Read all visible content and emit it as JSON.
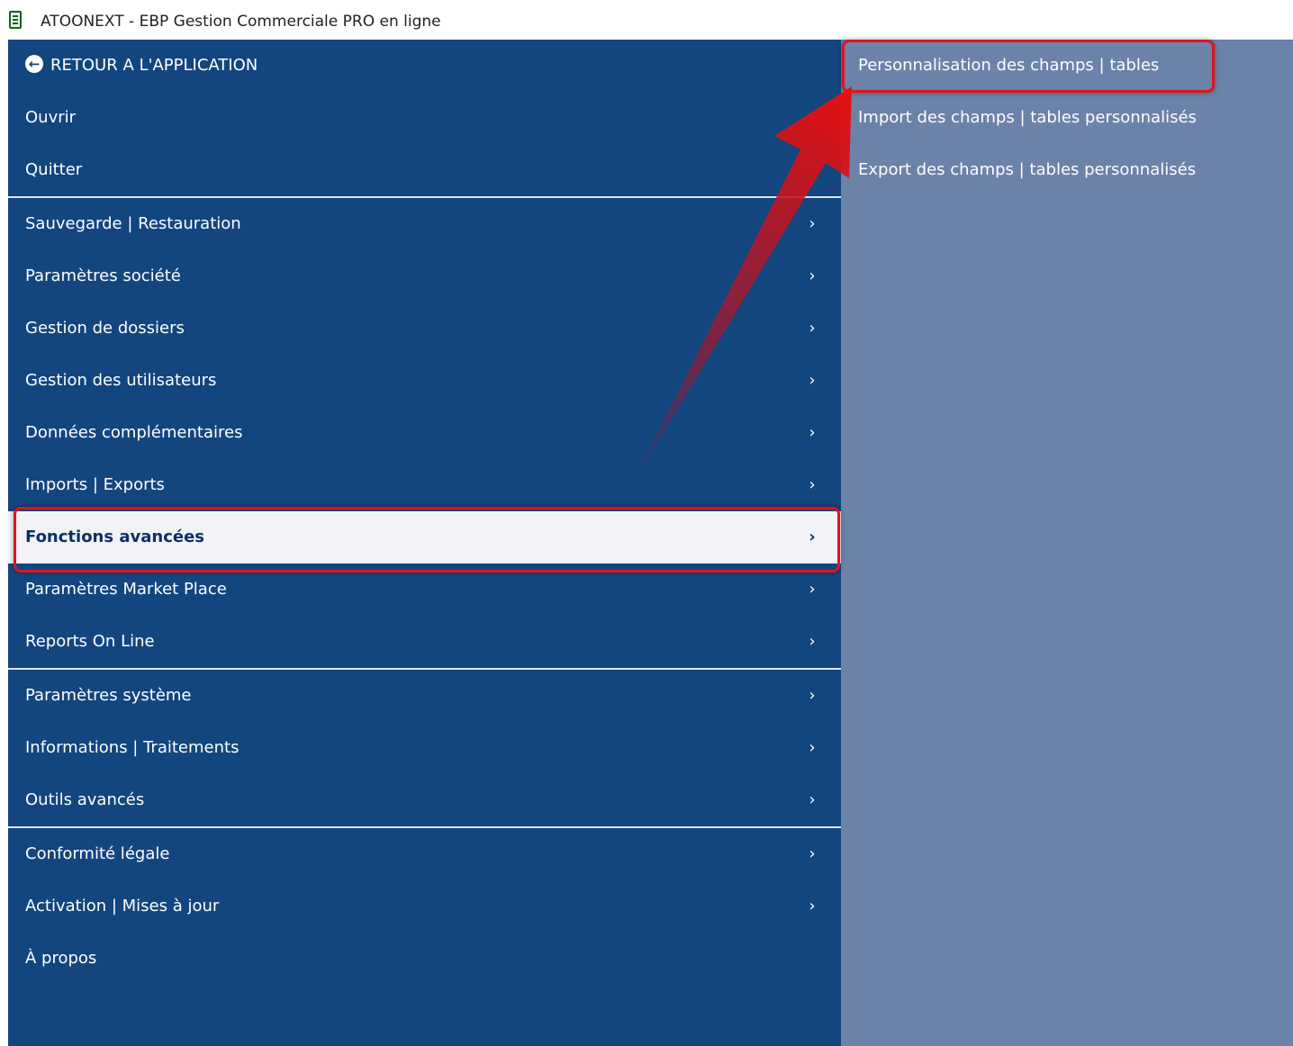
{
  "window": {
    "title": "ATOONEXT - EBP Gestion Commerciale PRO en ligne",
    "icon": "app-document-icon"
  },
  "menu": {
    "back_label": "RETOUR A L'APPLICATION",
    "items": [
      {
        "label": "Ouvrir",
        "has_submenu": true
      },
      {
        "label": "Quitter",
        "has_submenu": false
      },
      {
        "label": "Sauvegarde | Restauration",
        "has_submenu": true
      },
      {
        "label": "Paramètres société",
        "has_submenu": true
      },
      {
        "label": "Gestion de dossiers",
        "has_submenu": true
      },
      {
        "label": "Gestion des utilisateurs",
        "has_submenu": true
      },
      {
        "label": "Données complémentaires",
        "has_submenu": true
      },
      {
        "label": "Imports | Exports",
        "has_submenu": true
      },
      {
        "label": "Fonctions avancées",
        "has_submenu": true,
        "selected": true
      },
      {
        "label": "Paramètres Market Place",
        "has_submenu": true
      },
      {
        "label": "Reports On Line",
        "has_submenu": true
      },
      {
        "label": "Paramètres système",
        "has_submenu": true
      },
      {
        "label": "Informations | Traitements",
        "has_submenu": true
      },
      {
        "label": "Outils avancés",
        "has_submenu": true
      },
      {
        "label": "Conformité légale",
        "has_submenu": true
      },
      {
        "label": "Activation | Mises à jour",
        "has_submenu": true
      },
      {
        "label": "À propos",
        "has_submenu": false
      }
    ]
  },
  "submenu": {
    "items": [
      {
        "label": "Personnalisation des champs | tables",
        "highlighted": true
      },
      {
        "label": "Import des champs | tables personnalisés"
      },
      {
        "label": "Export des champs | tables personnalisés"
      }
    ]
  },
  "icons": {
    "chevron": "chevron-right-icon",
    "back": "arrow-left-circle-icon"
  },
  "colors": {
    "menu_bg": "#13457f",
    "submenu_bg": "#6b82a9",
    "selected_bg": "#f1f3f6",
    "annotation_red": "#e0141c"
  }
}
